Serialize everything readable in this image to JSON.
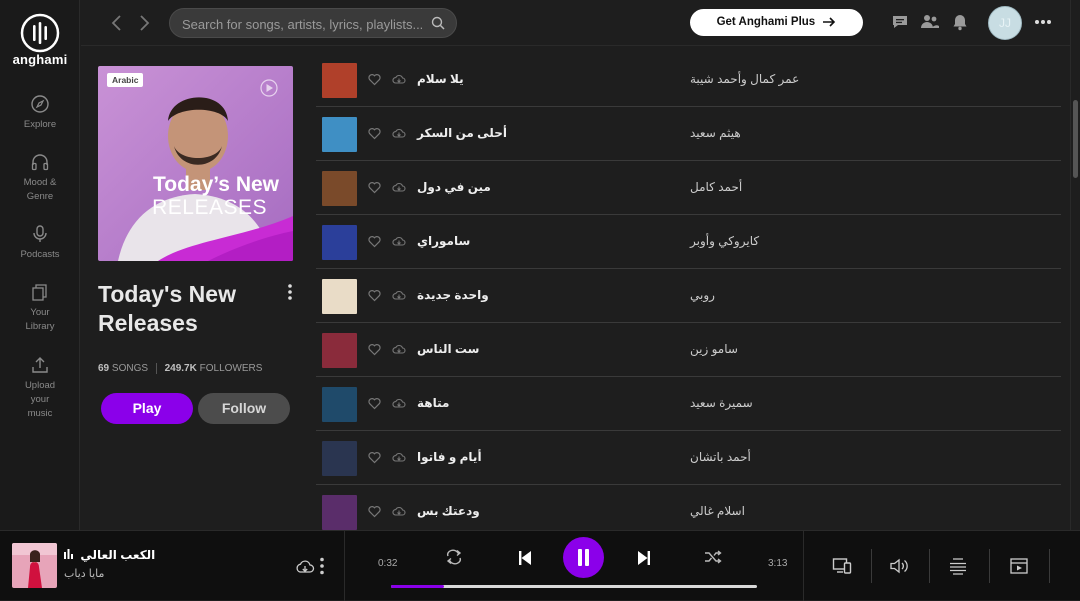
{
  "app": {
    "logo_text": "anghami"
  },
  "nav": {
    "items": [
      {
        "label": "Explore",
        "icon": "explore-icon"
      },
      {
        "label": "Mood &\nGenre",
        "icon": "headphones-icon"
      },
      {
        "label": "Podcasts",
        "icon": "microphone-icon"
      },
      {
        "label": "Your\nLibrary",
        "icon": "library-icon"
      },
      {
        "label": "Upload\nyour\nmusic",
        "icon": "upload-icon"
      }
    ]
  },
  "topbar": {
    "search_placeholder": "Search for songs, artists, lyrics, playlists...",
    "plus_label": "Get Anghami Plus",
    "avatar_initials": "JJ"
  },
  "playlist": {
    "badge": "Arabic",
    "cover_title_1": "Today’s New",
    "cover_title_2": "RELEASES",
    "title": "Today's New Releases",
    "songs_count": "69",
    "songs_label": "SONGS",
    "followers_count": "249.7K",
    "followers_label": "FOLLOWERS",
    "play_label": "Play",
    "follow_label": "Follow"
  },
  "tracks": [
    {
      "song": "يلا سلام",
      "artist": "عمر كمال وأحمد شيبة",
      "color": "#b0402a"
    },
    {
      "song": "أحلى من السكر",
      "artist": "هيثم سعيد",
      "color": "#3f8fc4"
    },
    {
      "song": "مين في دول",
      "artist": "أحمد كامل",
      "color": "#7a4a2a"
    },
    {
      "song": "ساموراي",
      "artist": "كايروكي وأوبر",
      "color": "#2b3f9a"
    },
    {
      "song": "واحدة جديدة",
      "artist": "روبي",
      "color": "#e9dcc7"
    },
    {
      "song": "ست الناس",
      "artist": "سامو زين",
      "color": "#8a2b3b"
    },
    {
      "song": "متاهة",
      "artist": "سميرة سعيد",
      "color": "#1f4a6a"
    },
    {
      "song": "أيام و فاتوا",
      "artist": "أحمد باتشان",
      "color": "#2a3550"
    },
    {
      "song": "ودعتك بس",
      "artist": "اسلام غالي",
      "color": "#5a2d6a"
    }
  ],
  "player": {
    "title": "الكعب العالي",
    "artist": "مايا دياب",
    "elapsed": "0:32",
    "duration": "3:13",
    "progress": 0.146
  }
}
